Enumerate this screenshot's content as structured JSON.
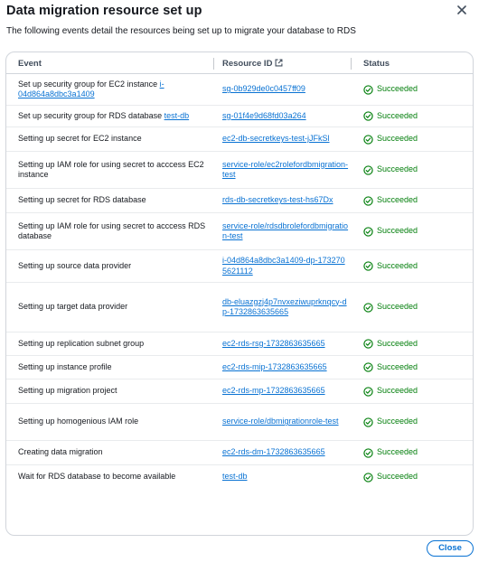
{
  "modal": {
    "title": "Data migration resource set up",
    "description": "The following events detail the resources being set up to migrate your database to RDS",
    "close_icon": "close-icon"
  },
  "table": {
    "columns": {
      "event": "Event",
      "resource_id": "Resource ID",
      "resource_icon": "external-link-icon",
      "status": "Status"
    },
    "status_icon": "check-circle-icon",
    "status_color": "#037f0c",
    "link_color": "#0972d3",
    "rows": [
      {
        "event": "Set up security group for EC2 instance ",
        "event_link": "i-04d864a8dbc3a1409",
        "resource": "sg-0b929de0c0457ff09",
        "status": "Succeeded"
      },
      {
        "event": "Set up security group for RDS database ",
        "event_link": "test-db",
        "resource": "sg-01f4e9d68fd03a264",
        "status": "Succeeded"
      },
      {
        "event": "Setting up secret for EC2 instance",
        "event_link": "",
        "resource": "ec2-db-secretkeys-test-jJFkSl",
        "status": "Succeeded"
      },
      {
        "event": "Setting up IAM role for using secret to acccess EC2 instance",
        "event_link": "",
        "resource": "service-role/ec2rolefordbmigration-test",
        "status": "Succeeded"
      },
      {
        "event": "Setting up secret for RDS database",
        "event_link": "",
        "resource": "rds-db-secretkeys-test-hs67Dx",
        "status": "Succeeded"
      },
      {
        "event": "Setting up IAM role for using secret to acccess RDS database",
        "event_link": "",
        "resource": "service-role/rdsdbrolefordbmigration-test",
        "status": "Succeeded"
      },
      {
        "event": "Setting up source data provider",
        "event_link": "",
        "resource": "i-04d864a8dbc3a1409-dp-1732705621112",
        "status": "Succeeded"
      },
      {
        "event": "Setting up target data provider",
        "event_link": "",
        "resource": "db-eluazgzj4p7nvxeziwuprknqcy-dp-1732863635665",
        "status": "Succeeded"
      },
      {
        "event": "Setting up replication subnet group",
        "event_link": "",
        "resource": "ec2-rds-rsg-1732863635665",
        "status": "Succeeded"
      },
      {
        "event": "Setting up instance profile",
        "event_link": "",
        "resource": "ec2-rds-mip-1732863635665",
        "status": "Succeeded"
      },
      {
        "event": "Setting up migration project",
        "event_link": "",
        "resource": "ec2-rds-mp-1732863635665",
        "status": "Succeeded"
      },
      {
        "event": "Setting up homogenious IAM role",
        "event_link": "",
        "resource": "service-role/dbmigrationrole-test",
        "status": "Succeeded"
      },
      {
        "event": "Creating data migration",
        "event_link": "",
        "resource": "ec2-rds-dm-1732863635665",
        "status": "Succeeded"
      },
      {
        "event": "Wait for RDS database to become available",
        "event_link": "",
        "resource": "test-db",
        "status": "Succeeded"
      }
    ]
  },
  "footer": {
    "close_label": "Close"
  }
}
